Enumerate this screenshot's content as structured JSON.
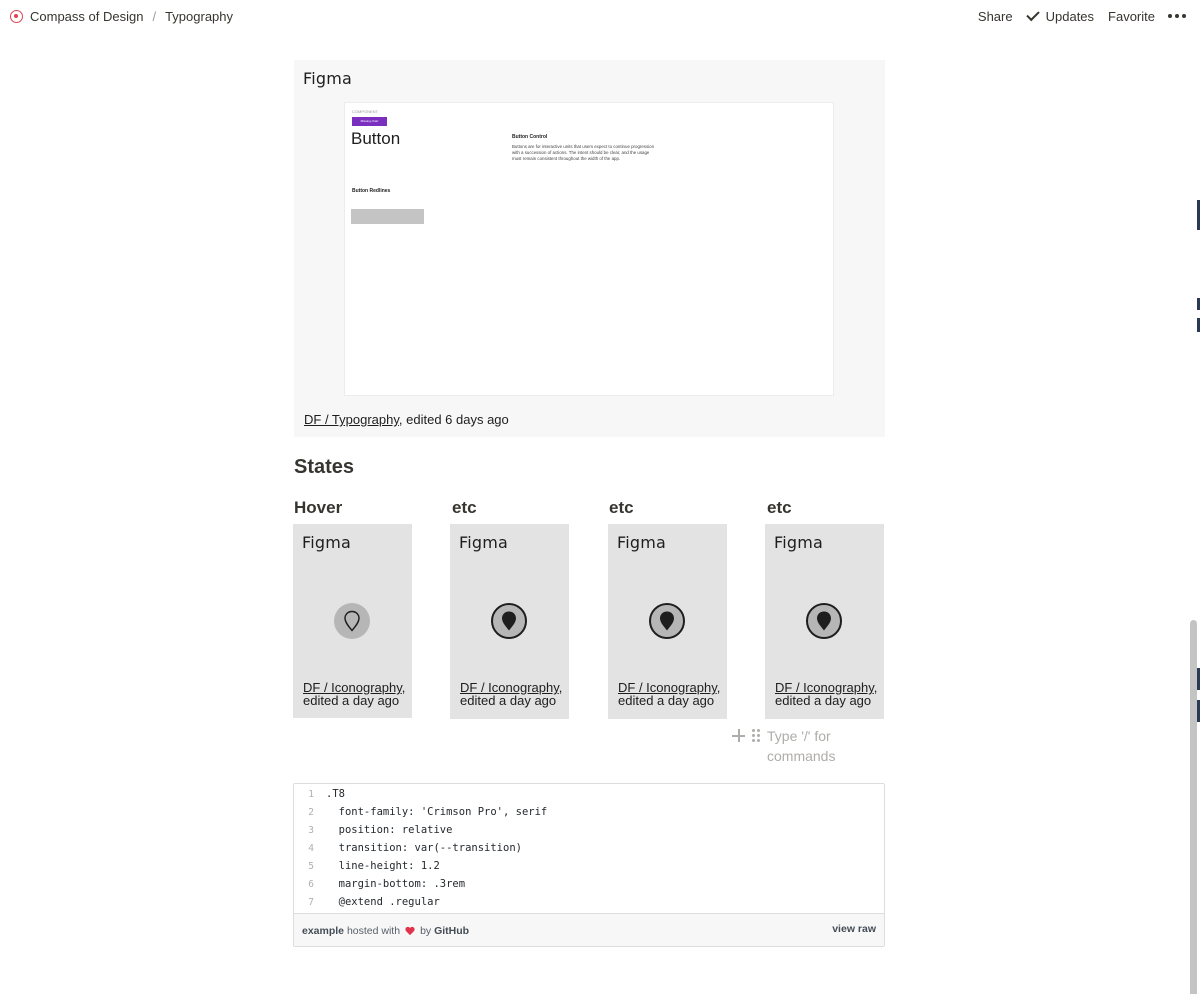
{
  "breadcrumb": {
    "workspace": "Compass of Design",
    "separator": "/",
    "page": "Typography"
  },
  "topbar": {
    "share": "Share",
    "updates": "Updates",
    "favorite": "Favorite"
  },
  "figma_label": "Figma",
  "main_embed": {
    "preview": {
      "component_label": "COMPONENT",
      "chip_label": "Missing chart",
      "title": "Button",
      "control_title": "Button Control",
      "control_body": "Buttons are for interactive units that users expect to continue progression with a succession of actions. The intent should be clear, and the usage must remain consistent throughout the width of the app.",
      "redlines_label": "Button Redlines"
    },
    "link": "DF / Typography",
    "edited": ", edited 6 days ago"
  },
  "states_heading": "States",
  "state_embeds": [
    {
      "label": "Hover",
      "link": "DF / Iconography",
      "edited": ", edited a day ago"
    },
    {
      "label": "etc",
      "link": "DF / Iconography",
      "edited": ", edited a day ago"
    },
    {
      "label": "etc",
      "link": "DF / Iconography",
      "edited": ", edited a day ago"
    },
    {
      "label": "etc",
      "link": "DF / Iconography",
      "edited": ", edited a day ago"
    }
  ],
  "block_placeholder": "Type '/' for commands",
  "gist": {
    "lines": [
      {
        "n": "1",
        "code": ".T8"
      },
      {
        "n": "2",
        "code": "  font-family: 'Crimson Pro', serif"
      },
      {
        "n": "3",
        "code": "  position: relative"
      },
      {
        "n": "4",
        "code": "  transition: var(--transition)"
      },
      {
        "n": "5",
        "code": "  line-height: 1.2"
      },
      {
        "n": "6",
        "code": "  margin-bottom: .3rem"
      },
      {
        "n": "7",
        "code": "  @extend .regular"
      }
    ],
    "footer": {
      "filename": "example",
      "hosted_with": "hosted with",
      "by": "by",
      "github": "GitHub",
      "view_raw": "view raw"
    }
  },
  "colors": {
    "accent_purple": "#7b2fbe",
    "workspace_icon": "#e0444e",
    "embed_bg": "#e3e3e3"
  }
}
